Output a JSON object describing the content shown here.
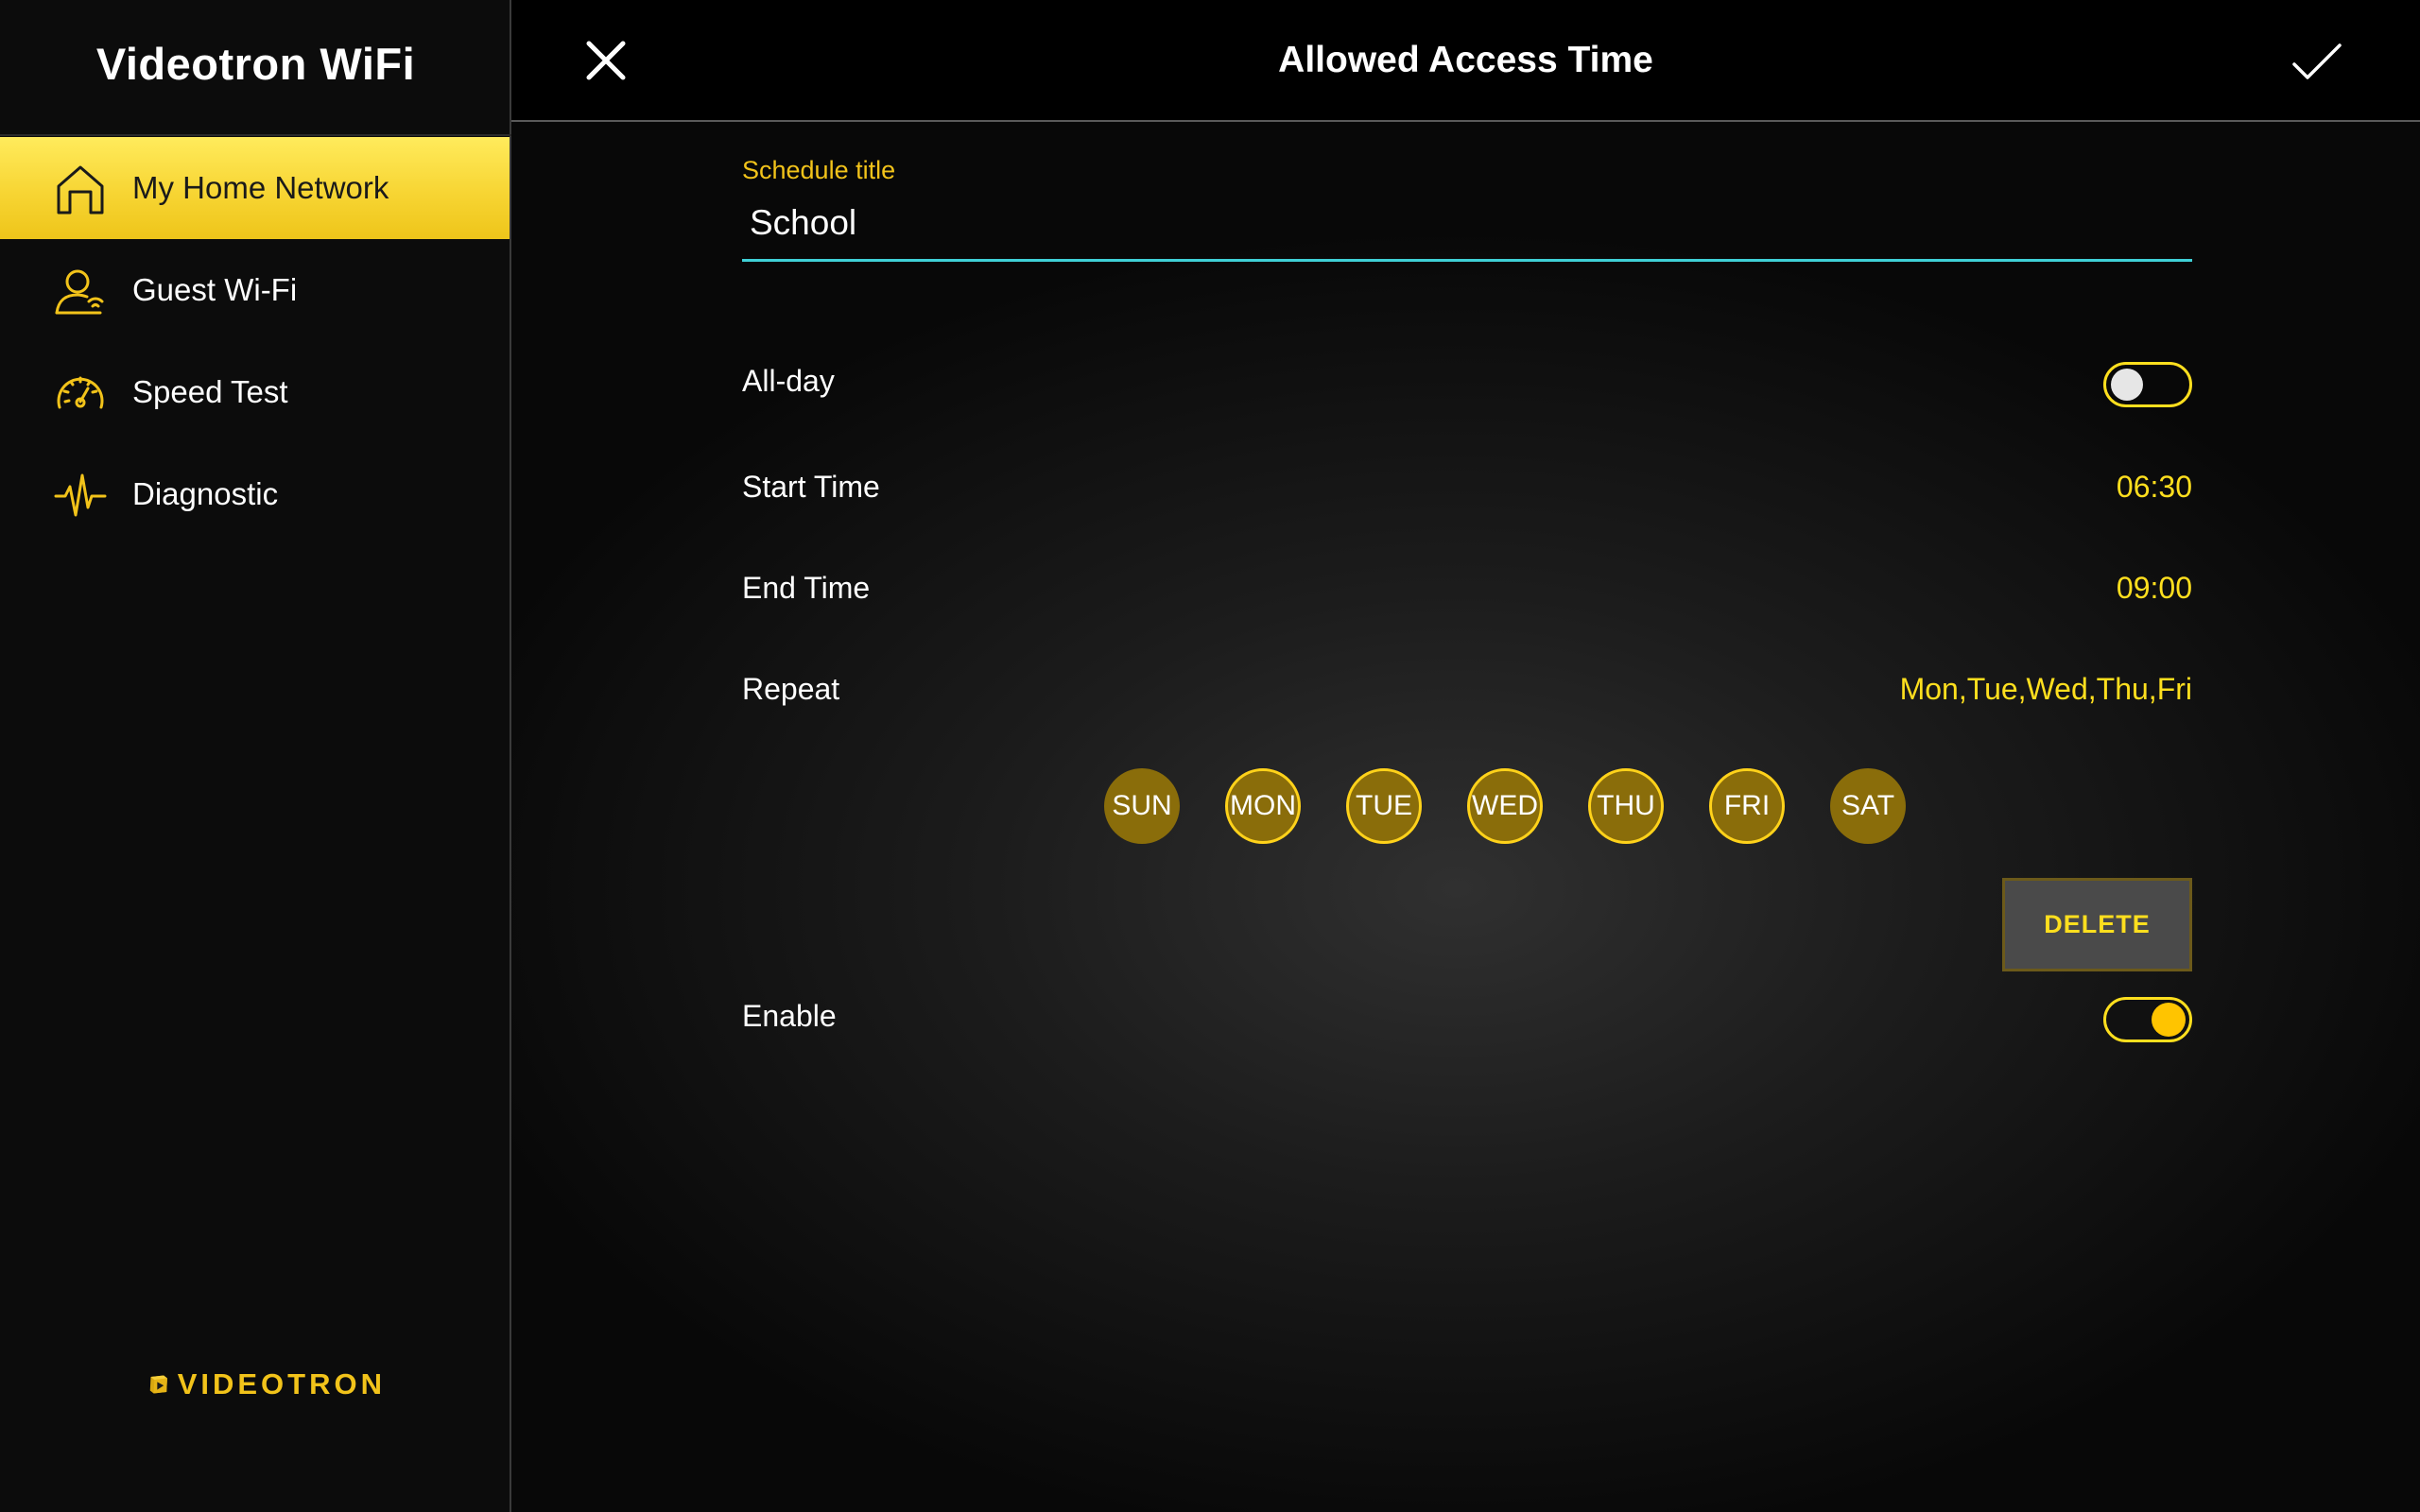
{
  "app": {
    "title": "Videotron WiFi",
    "brand": "VIDEOTRON"
  },
  "sidebar": {
    "items": [
      {
        "label": "My Home Network",
        "icon": "home-icon",
        "active": true
      },
      {
        "label": "Guest Wi-Fi",
        "icon": "guest-user-icon",
        "active": false
      },
      {
        "label": "Speed Test",
        "icon": "speedometer-icon",
        "active": false
      },
      {
        "label": "Diagnostic",
        "icon": "pulse-icon",
        "active": false
      }
    ]
  },
  "header": {
    "title": "Allowed Access Time",
    "close_icon": "close-icon",
    "confirm_icon": "checkmark-icon"
  },
  "form": {
    "schedule_title": {
      "label": "Schedule title",
      "value": "School"
    },
    "all_day": {
      "label": "All-day",
      "enabled": false
    },
    "start_time": {
      "label": "Start Time",
      "value": "06:30"
    },
    "end_time": {
      "label": "End Time",
      "value": "09:00"
    },
    "repeat": {
      "label": "Repeat",
      "value": "Mon,Tue,Wed,Thu,Fri"
    },
    "days": [
      {
        "label": "SUN",
        "selected": false
      },
      {
        "label": "MON",
        "selected": true
      },
      {
        "label": "TUE",
        "selected": true
      },
      {
        "label": "WED",
        "selected": true
      },
      {
        "label": "THU",
        "selected": true
      },
      {
        "label": "FRI",
        "selected": true
      },
      {
        "label": "SAT",
        "selected": false
      }
    ],
    "delete_label": "DELETE",
    "enable": {
      "label": "Enable",
      "enabled": true
    }
  },
  "colors": {
    "accent": "#ffdf1e",
    "active_nav": "#f7d533",
    "input_underline": "#3fd0d6",
    "day_fill": "#8a6d0a"
  }
}
